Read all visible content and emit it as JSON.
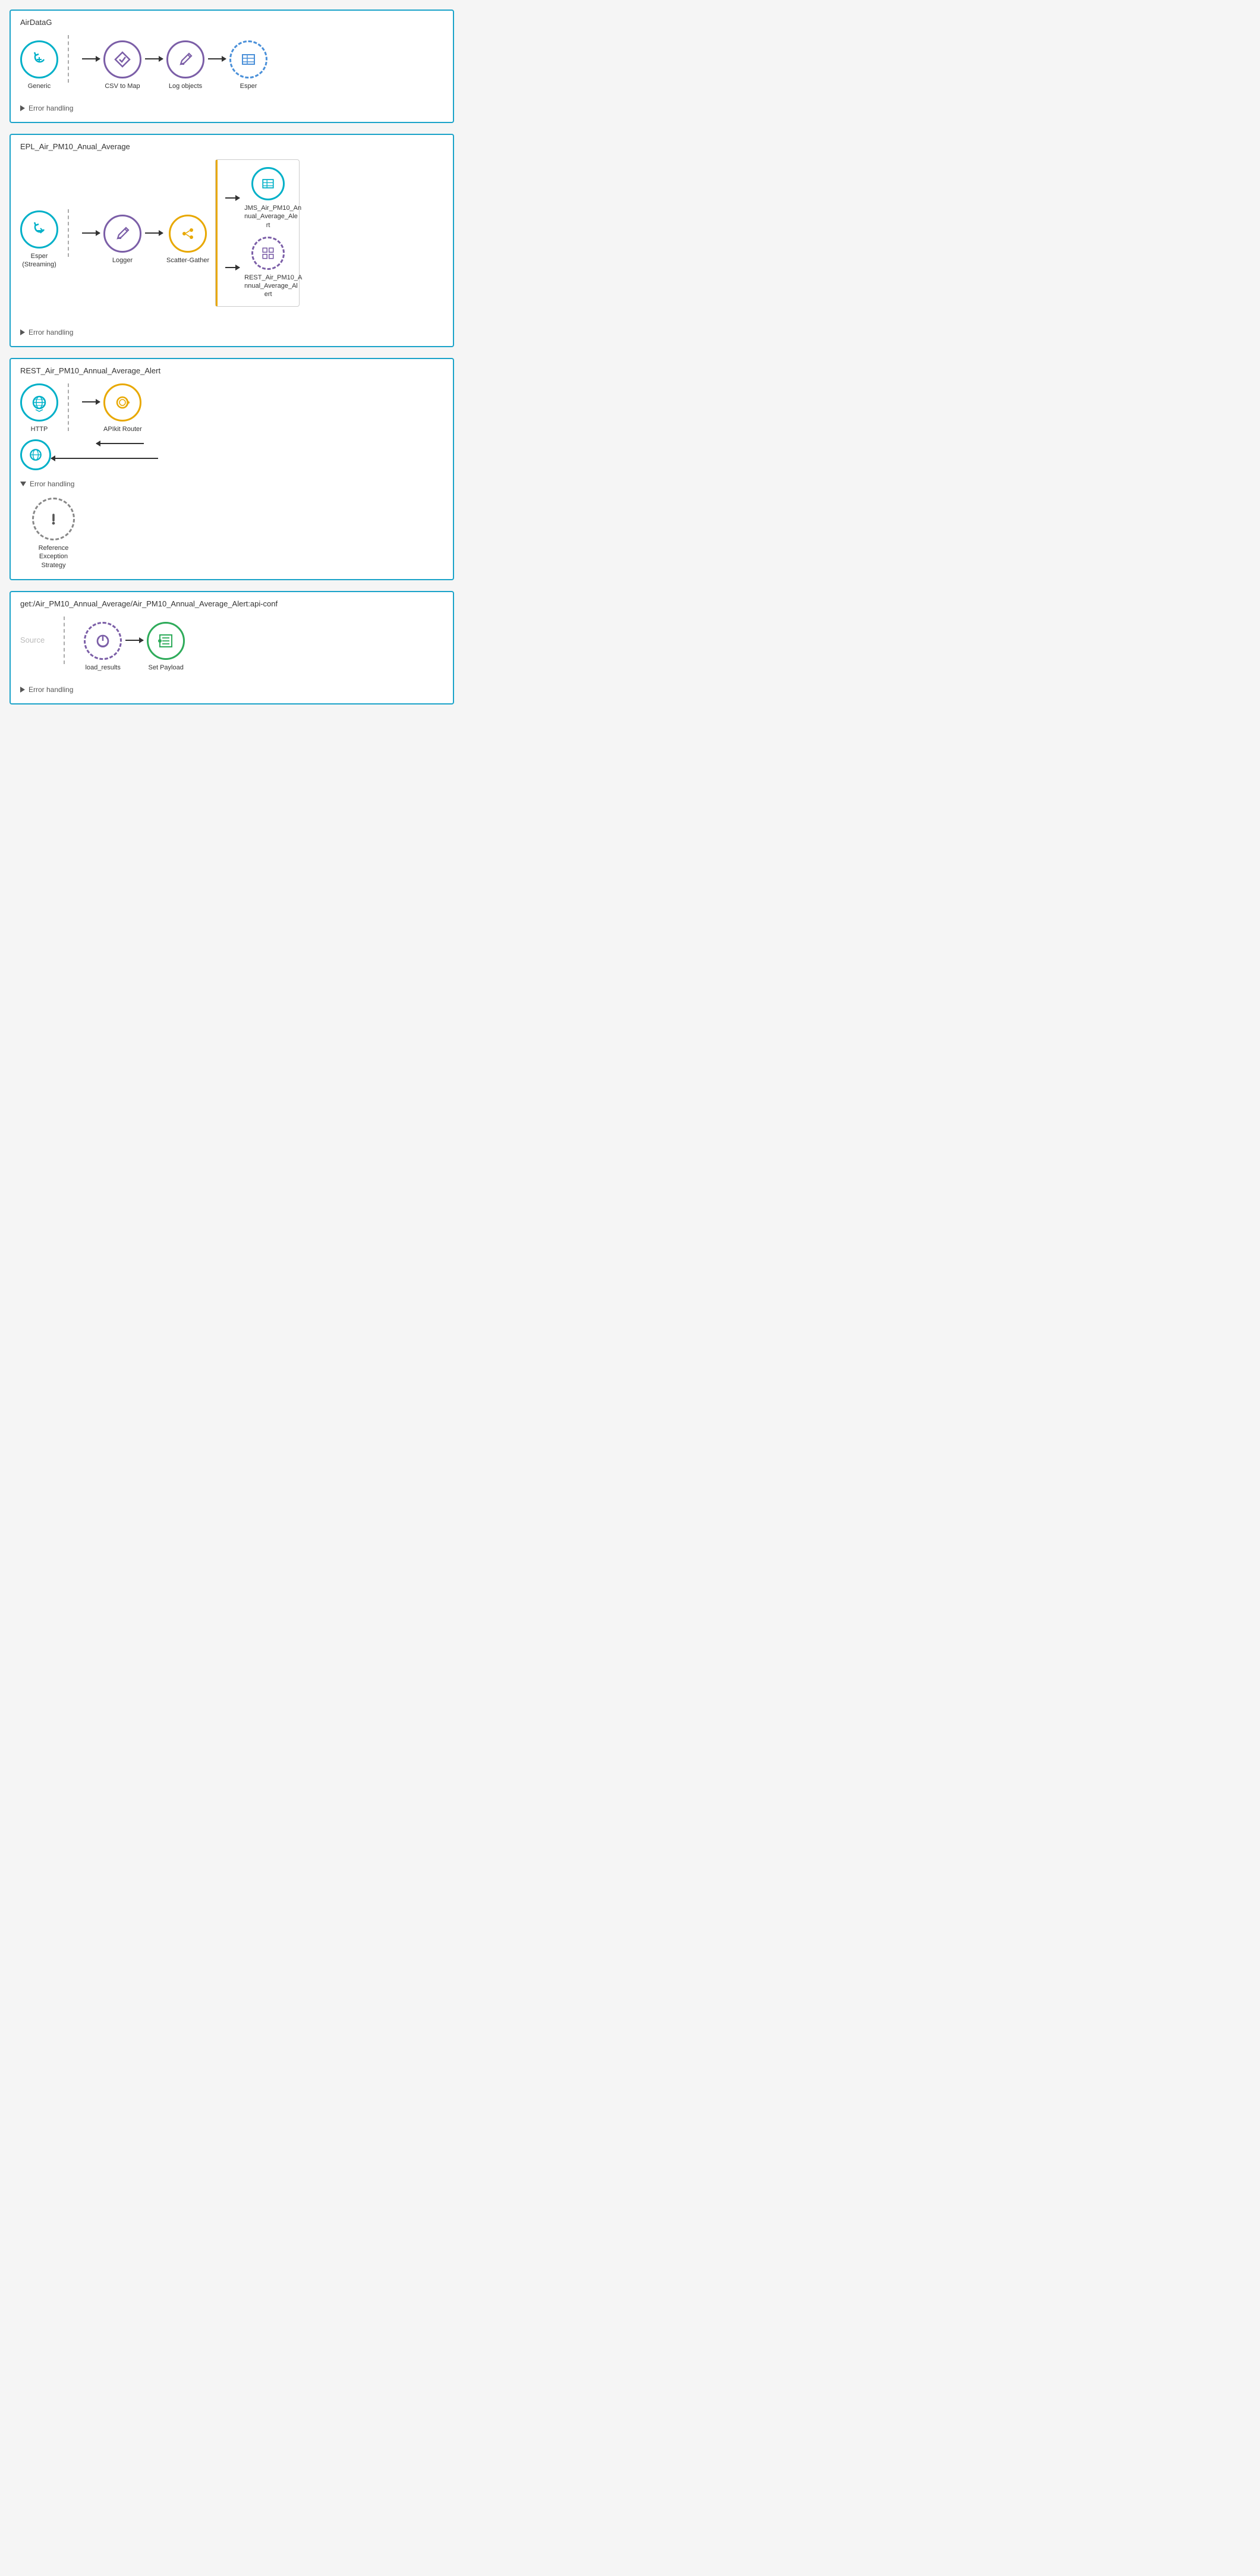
{
  "flows": [
    {
      "id": "flow-airdatag",
      "title": "AirDataG",
      "nodes": [
        {
          "id": "generic",
          "label": "Generic",
          "circleType": "teal",
          "iconType": "rotate-ccw"
        },
        {
          "id": "csv-to-map",
          "label": "CSV to Map",
          "circleType": "purple",
          "iconType": "diamond-check"
        },
        {
          "id": "log-objects",
          "label": "Log objects",
          "circleType": "purple",
          "iconType": "pencil"
        },
        {
          "id": "esper",
          "label": "Esper",
          "circleType": "blue-dashed",
          "iconType": "table"
        }
      ],
      "errorHandling": {
        "label": "Error handling",
        "expanded": false
      }
    },
    {
      "id": "flow-epl",
      "title": "EPL_Air_PM10_Anual_Average",
      "leftNodes": [
        {
          "id": "esper-streaming",
          "label": "Esper\n(Streaming)",
          "circleType": "teal",
          "iconType": "rotate-ccw"
        },
        {
          "id": "logger",
          "label": "Logger",
          "circleType": "purple",
          "iconType": "pencil"
        }
      ],
      "scatterNode": {
        "id": "scatter-gather",
        "label": "Scatter-Gather",
        "circleType": "orange",
        "iconType": "scatter"
      },
      "scatterOutputs": [
        {
          "id": "jms-alert",
          "label": "JMS_Air_PM10_An\nnual_Average_Ale\nrt",
          "circleType": "teal",
          "iconType": "table"
        },
        {
          "id": "rest-alert",
          "label": "REST_Air_PM10_A\nnnual_Average_Al\nert",
          "circleType": "purple",
          "iconType": "grid"
        }
      ],
      "errorHandling": {
        "label": "Error handling",
        "expanded": false
      }
    },
    {
      "id": "flow-rest",
      "title": "REST_Air_PM10_Annual_Average_Alert",
      "nodes": [
        {
          "id": "http",
          "label": "HTTP",
          "circleType": "teal",
          "iconType": "globe"
        },
        {
          "id": "apikit-router",
          "label": "APIkit Router",
          "circleType": "orange",
          "iconType": "apikit"
        }
      ],
      "returnNode": {
        "id": "http-return",
        "label": "",
        "circleType": "teal",
        "iconType": "globe"
      },
      "errorHandling": {
        "label": "Error handling",
        "expanded": true,
        "nodes": [
          {
            "id": "ref-exception",
            "label": "Reference\nException\nStrategy",
            "circleType": "gray-dashed",
            "iconType": "exclamation"
          }
        ]
      }
    },
    {
      "id": "flow-get",
      "title": "get:/Air_PM10_Annual_Average/Air_PM10_Annual_Average_Alert:api-conf",
      "sourceLabel": "Source",
      "nodes": [
        {
          "id": "load-results",
          "label": "load_results",
          "circleType": "purple-dashed",
          "iconType": "power"
        },
        {
          "id": "set-payload",
          "label": "Set Payload",
          "circleType": "green",
          "iconType": "list"
        }
      ],
      "errorHandling": {
        "label": "Error handling",
        "expanded": false
      }
    }
  ]
}
